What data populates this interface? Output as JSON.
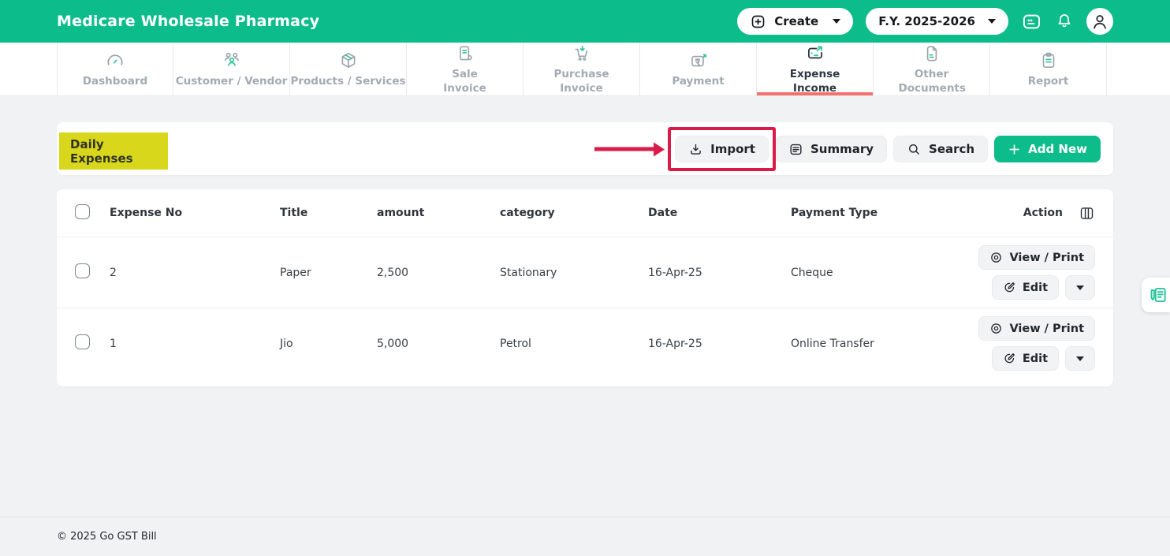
{
  "header": {
    "title": "Medicare Wholesale Pharmacy",
    "create_label": "Create",
    "fy_label": "F.Y. 2025-2026"
  },
  "nav": {
    "tabs": [
      {
        "label": "Dashboard",
        "icon": "gauge-icon",
        "active": false
      },
      {
        "label": "Customer / Vendor",
        "icon": "users-icon",
        "active": false
      },
      {
        "label": "Products / Services",
        "icon": "cube-icon",
        "active": false
      },
      {
        "label": "Sale Invoice",
        "icon": "invoice-icon",
        "active": false
      },
      {
        "label": "Purchase Invoice",
        "icon": "cart-icon",
        "active": false
      },
      {
        "label": "Payment",
        "icon": "rupee-card-icon",
        "active": false
      },
      {
        "label": "Expense Income",
        "icon": "wallet-arrow-icon",
        "active": true
      },
      {
        "label": "Other Documents",
        "icon": "document-icon",
        "active": false
      },
      {
        "label": "Report",
        "icon": "clipboard-icon",
        "active": false
      }
    ]
  },
  "toolbar": {
    "page_title": "Daily Expenses",
    "import_label": "Import",
    "summary_label": "Summary",
    "search_label": "Search",
    "add_new_label": "Add New"
  },
  "table": {
    "headers": [
      "Expense No",
      "Title",
      "amount",
      "category",
      "Date",
      "Payment Type",
      "Action"
    ],
    "actions": {
      "view_print": "View / Print",
      "edit": "Edit"
    },
    "rows": [
      {
        "expense_no": "2",
        "title": "Paper",
        "amount": "2,500",
        "category": "Stationary",
        "date": "16-Apr-25",
        "payment_type": "Cheque"
      },
      {
        "expense_no": "1",
        "title": "Jio",
        "amount": "5,000",
        "category": "Petrol",
        "date": "16-Apr-25",
        "payment_type": "Online Transfer"
      }
    ]
  },
  "footer": {
    "copyright": "© 2025 Go GST Bill"
  },
  "colors": {
    "brand_green": "#0cbd8b",
    "active_tab_underline": "#f4716e",
    "annotation_red": "#d91b49",
    "highlight_yellow": "#d8d71b"
  },
  "icons": {
    "plus-square-icon": "⊞",
    "caret-down-icon": "▾",
    "message-icon": "▭",
    "bell-icon": "🔔",
    "user-avatar-icon": "👤",
    "download-icon": "⭳",
    "summary-list-icon": "☰",
    "search-icon": "🔍",
    "plus-icon": "+",
    "view-eye-icon": "◎",
    "edit-pen-icon": "✎",
    "columns-icon": "▥",
    "feedback-pen-icon": "✎",
    "checkbox": "☐",
    "annotation-arrow": "➜"
  }
}
